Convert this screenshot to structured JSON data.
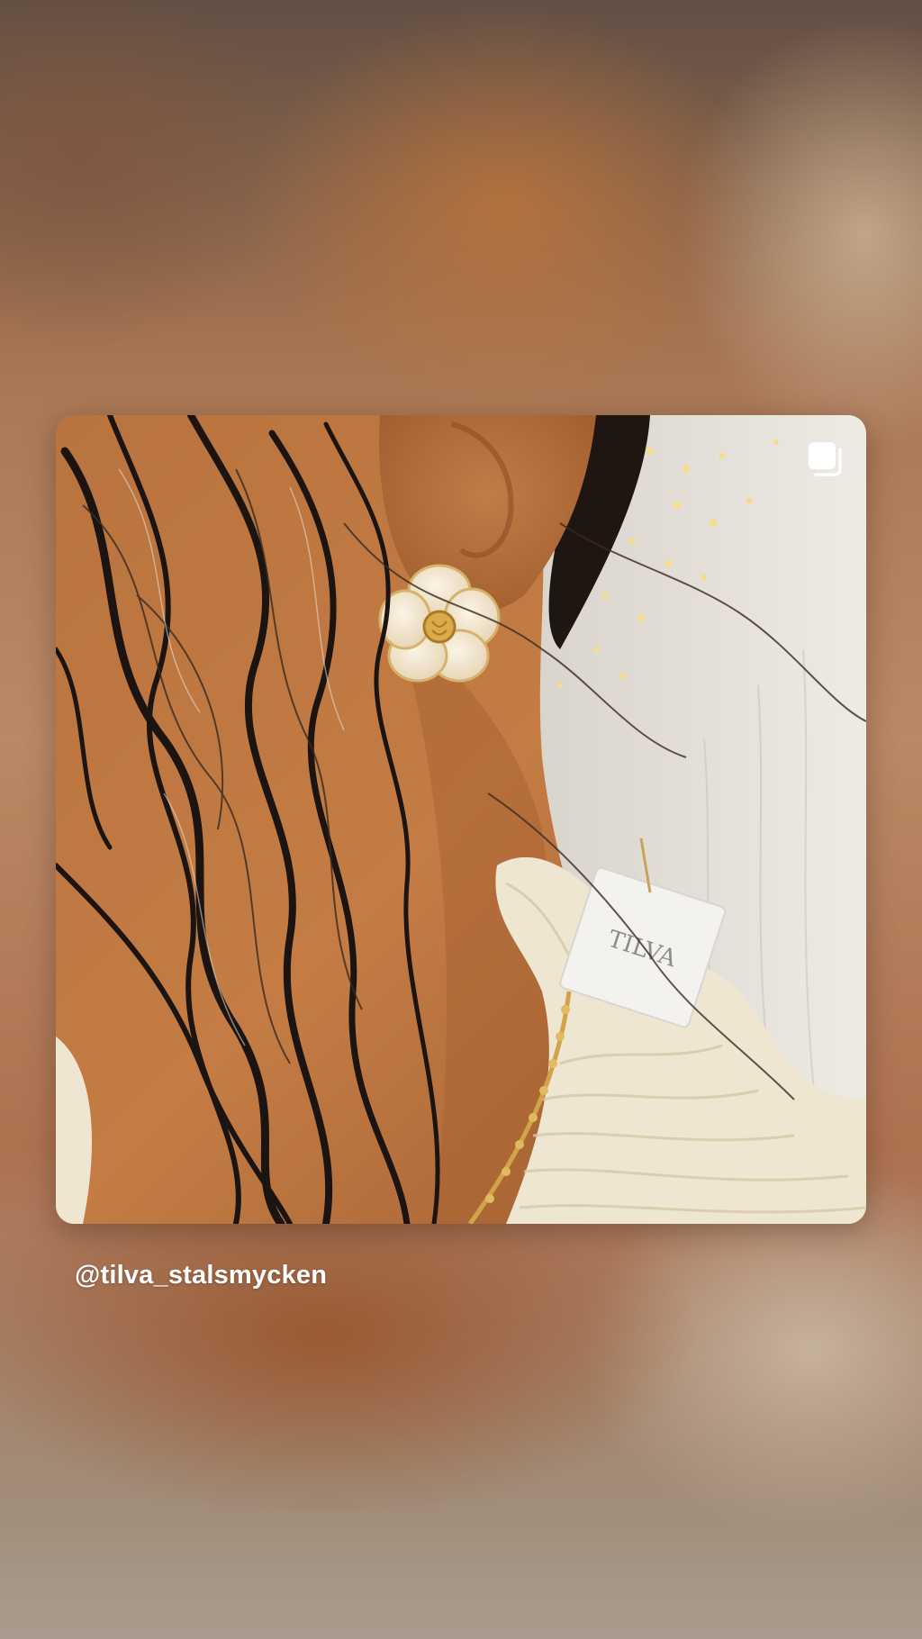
{
  "story": {
    "username": "@tilva_stalsmycken",
    "post": {
      "image_alt": "Close-up of an ear wearing a cream flower earring with a gold chain necklace and a TILVA tag",
      "tag_text": "TILVA",
      "icon": "multi-post-icon"
    }
  },
  "colors": {
    "username_text": "#ffffff",
    "skin_tone": "#b06a3c",
    "blouse": "#efe6d2",
    "gold": "#d1a44a"
  }
}
